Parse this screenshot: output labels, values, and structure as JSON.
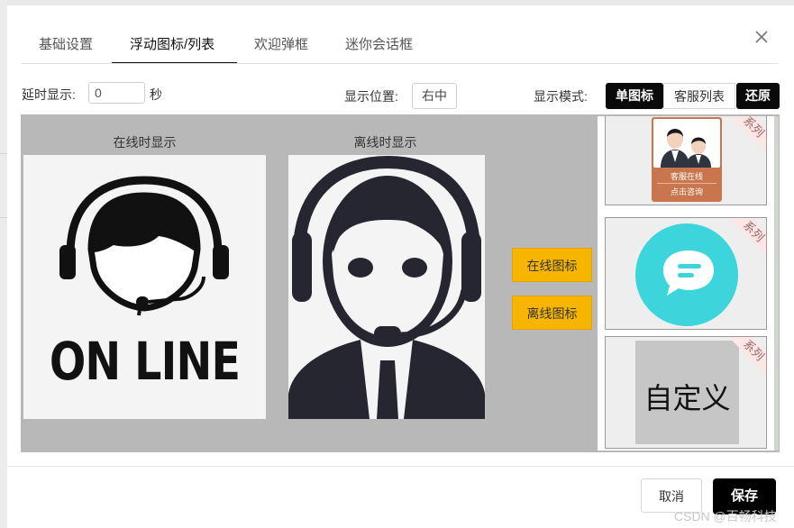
{
  "tabs": [
    {
      "label": "基础设置"
    },
    {
      "label": "浮动图标/列表"
    },
    {
      "label": "欢迎弹框"
    },
    {
      "label": "迷你会话框"
    }
  ],
  "toolbar": {
    "delay_label": "延时显示:",
    "delay_value": "0",
    "delay_unit": "秒",
    "position_label": "显示位置:",
    "position_value": "右中",
    "mode_label": "显示模式:",
    "mode_single": "单图标",
    "mode_list": "客服列表",
    "restore": "还原"
  },
  "preview": {
    "online_caption": "在线时显示",
    "offline_caption": "离线时显示",
    "online_image_text": "ON LINE",
    "online_button": "在线图标",
    "offline_button": "离线图标"
  },
  "series": {
    "ribbon": "系列",
    "card1_line1": "客服在线",
    "card1_line2": "点击咨询",
    "card3_text": "自定义"
  },
  "footer": {
    "cancel": "取消",
    "save": "保存",
    "watermark": "CSDN @百畅科技"
  },
  "colors": {
    "accent": "#000000",
    "button_yellow": "#f7b500",
    "chat_icon": "#3dd5dc"
  }
}
